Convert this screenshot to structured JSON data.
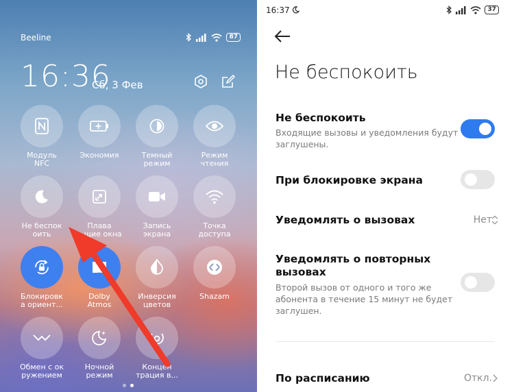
{
  "control_center": {
    "carrier": "Beeline",
    "battery": "87",
    "time": "16:36",
    "date": "Сб, 3 Фев",
    "tiles": [
      {
        "label": "Модуль\nNFC",
        "icon": "nfc-icon",
        "active": false
      },
      {
        "label": "Экономия",
        "icon": "battery-saver-icon",
        "active": false
      },
      {
        "label": "Темный\nрежим",
        "icon": "dark-mode-icon",
        "active": false
      },
      {
        "label": "Режим\nчтения",
        "icon": "eye-icon",
        "active": false
      },
      {
        "label": "Не беспок\nоить",
        "icon": "moon-icon",
        "active": false
      },
      {
        "label": "Плава\n...щие окна",
        "icon": "floating-window-icon",
        "active": false
      },
      {
        "label": "Запись\nэкрана",
        "icon": "video-camera-icon",
        "active": false
      },
      {
        "label": "Точка\nдоступа",
        "icon": "hotspot-icon",
        "active": false
      },
      {
        "label": "Блокировк\nа ориент...",
        "icon": "rotation-lock-icon",
        "active": true
      },
      {
        "label": "Dolby\nAtmos",
        "icon": "dolby-icon",
        "active": true
      },
      {
        "label": "Инверсия\nцветов",
        "icon": "invert-colors-icon",
        "active": false
      },
      {
        "label": "Shazam",
        "icon": "shazam-icon",
        "active": false
      },
      {
        "label": "Обмен с ок\nружением",
        "icon": "nearby-share-icon",
        "active": false
      },
      {
        "label": "Ночной\nрежим",
        "icon": "night-mode-icon",
        "active": false
      },
      {
        "label": "Концен\nтрация в...",
        "icon": "focus-icon",
        "active": false
      }
    ],
    "page_indicator": {
      "pages": 2,
      "current": 2
    }
  },
  "settings": {
    "status_time": "16:37",
    "battery": "37",
    "page_title": "Не беспокоить",
    "dnd": {
      "title": "Не беспокоить",
      "subtitle": "Входящие вызовы и уведомления будут заглушены.",
      "enabled": true
    },
    "lock_screen": {
      "title": "При блокировке экрана",
      "enabled": false
    },
    "calls": {
      "title": "Уведомлять о вызовах",
      "value": "Нет"
    },
    "repeat_calls": {
      "title": "Уведомлять о повторных вызовах",
      "subtitle": "Второй вызов от одного и того же абонента в течение 15 минут не будет заглушен.",
      "enabled": false
    },
    "schedule": {
      "title": "По расписанию",
      "value": "Откл."
    }
  },
  "colors": {
    "accent": "#2e7bf0",
    "annotation_arrow": "#f03a2a"
  }
}
